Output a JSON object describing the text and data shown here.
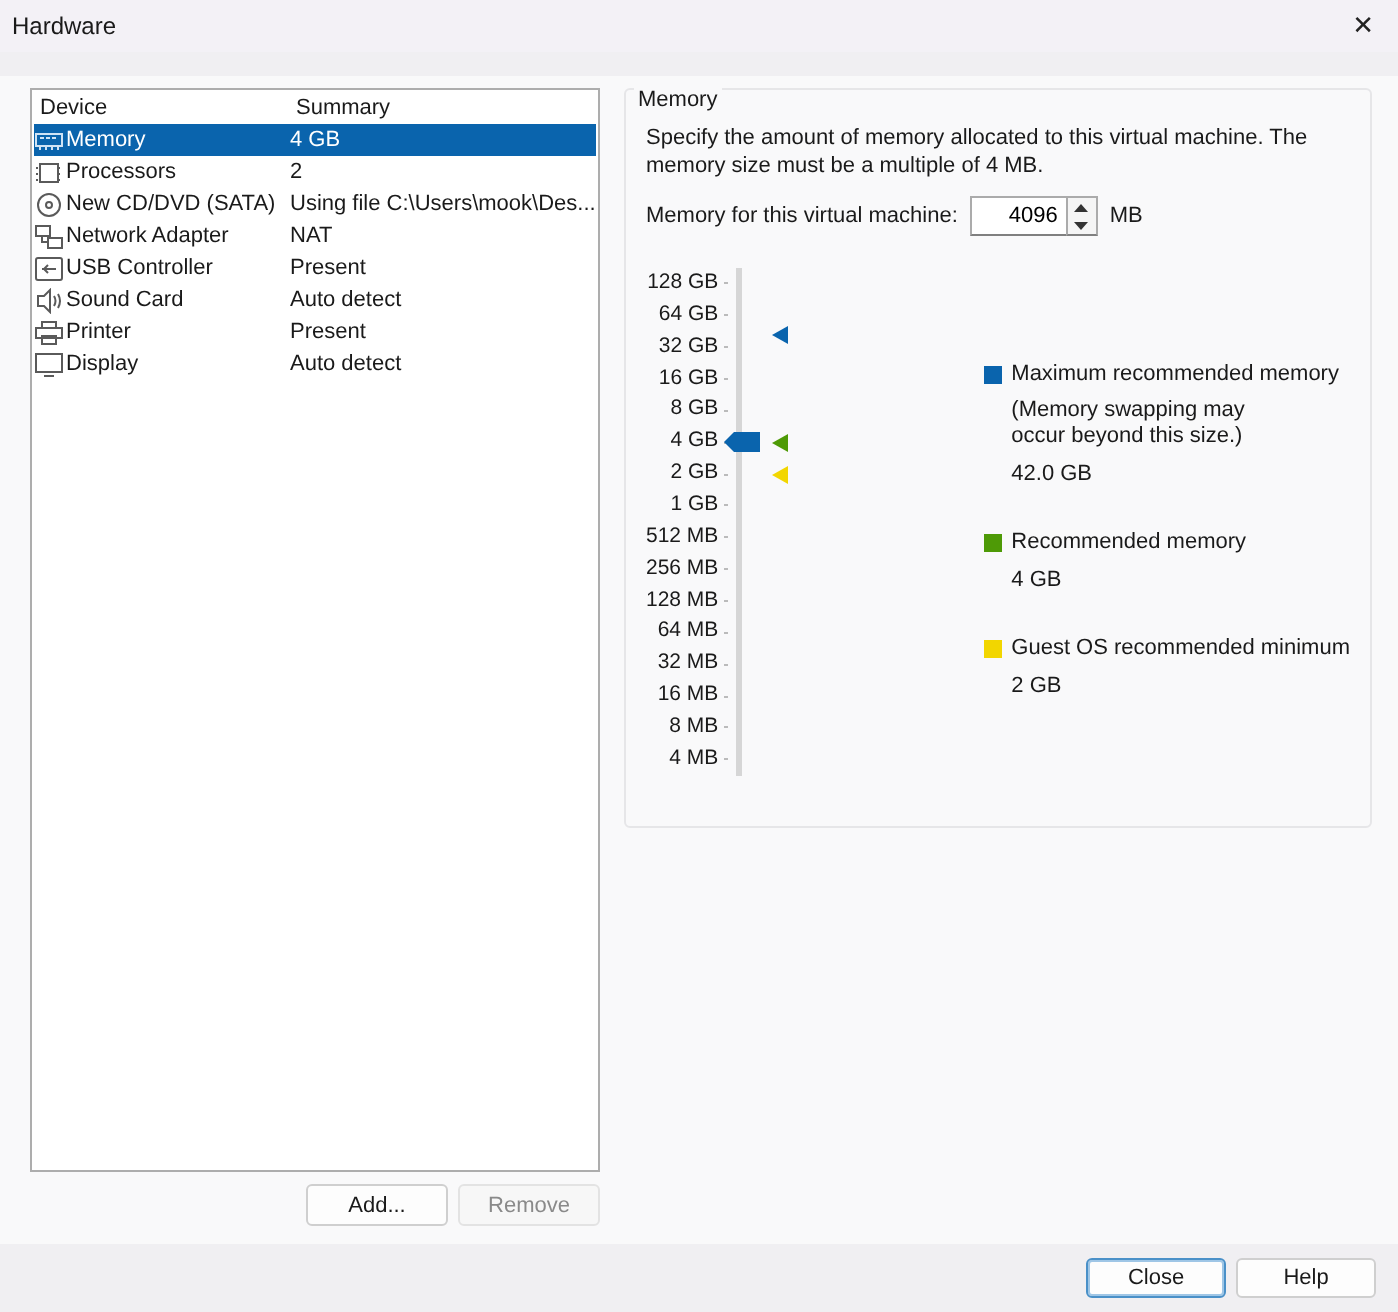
{
  "window": {
    "title": "Hardware",
    "close": "✕"
  },
  "device_list": {
    "columns": [
      "Device",
      "Summary"
    ],
    "rows": [
      {
        "kind": "memory",
        "device": "Memory",
        "summary": "4 GB",
        "selected": true
      },
      {
        "kind": "processor",
        "device": "Processors",
        "summary": "2",
        "selected": false
      },
      {
        "kind": "disc",
        "device": "New CD/DVD (SATA)",
        "summary": "Using file C:\\Users\\mook\\Des...",
        "selected": false
      },
      {
        "kind": "network",
        "device": "Network Adapter",
        "summary": "NAT",
        "selected": false
      },
      {
        "kind": "usb",
        "device": "USB Controller",
        "summary": "Present",
        "selected": false
      },
      {
        "kind": "sound",
        "device": "Sound Card",
        "summary": "Auto detect",
        "selected": false
      },
      {
        "kind": "printer",
        "device": "Printer",
        "summary": "Present",
        "selected": false
      },
      {
        "kind": "display",
        "device": "Display",
        "summary": "Auto detect",
        "selected": false
      }
    ]
  },
  "list_buttons": [
    {
      "label": "Add...",
      "disabled": false
    },
    {
      "label": "Remove",
      "disabled": true
    }
  ],
  "memory": {
    "title": "Memory",
    "description": "Specify the amount of memory allocated to this virtual machine. The memory size must be a multiple of 4 MB.",
    "field_label": "Memory for this virtual machine:",
    "value": "4096",
    "unit": "MB",
    "scale": [
      "128 GB",
      "64 GB",
      "32 GB",
      "16 GB",
      "8 GB",
      "4 GB",
      "2 GB",
      "1 GB",
      "512 MB",
      "256 MB",
      "128 MB",
      "64 MB",
      "32 MB",
      "16 MB",
      "8 MB",
      "4 MB"
    ],
    "slider": {
      "level": 0.667,
      "markers": [
        {
          "color": "#0a64ad",
          "level": 0.893
        },
        {
          "color": "#4e9a06",
          "level": 0.667
        },
        {
          "color": "#f2d600",
          "level": 0.6
        }
      ]
    },
    "legend": [
      {
        "label": "Maximum recommended memory",
        "note": "(Memory swapping may\noccur beyond this size.)",
        "value": "42.0 GB",
        "color": "#0a64ad"
      },
      {
        "label": "Recommended memory",
        "value": "4 GB",
        "color": "#4e9a06"
      },
      {
        "label": "Guest OS recommended minimum",
        "value": "2 GB",
        "color": "#f2d600"
      }
    ]
  },
  "footer_buttons": [
    {
      "label": "Close",
      "focused": true
    },
    {
      "label": "Help",
      "focused": false
    }
  ]
}
